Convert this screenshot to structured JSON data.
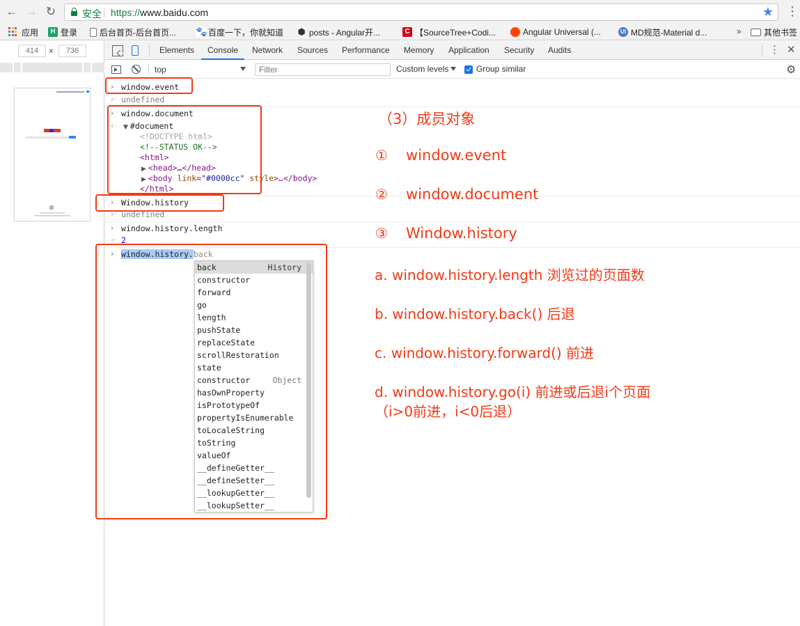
{
  "browser": {
    "secure_label": "安全",
    "url_scheme": "https://",
    "url_host": "www.baidu.com",
    "bookmarks": [
      {
        "label": "应用",
        "icon": "apps-grid-icon"
      },
      {
        "label": "登录",
        "icon": "h-logo-icon"
      },
      {
        "label": "后台首页-后台首页...",
        "icon": "page-icon"
      },
      {
        "label": "百度一下，你就知道",
        "icon": "baidu-paw-icon"
      },
      {
        "label": "posts - Angular开...",
        "icon": "hexagon-icon"
      },
      {
        "label": "【SourceTree+Codi...",
        "icon": "c-logo-icon"
      },
      {
        "label": "Angular Universal (...",
        "icon": "reddit-icon"
      },
      {
        "label": "MD规范-Material d...",
        "icon": "ui-logo-icon"
      }
    ],
    "overflow": "»",
    "other_bookmarks": "其他书签"
  },
  "device": {
    "width": "414",
    "height": "736",
    "x": "×"
  },
  "devtools": {
    "tabs": [
      "Elements",
      "Console",
      "Network",
      "Sources",
      "Performance",
      "Memory",
      "Application",
      "Security",
      "Audits"
    ],
    "active_tab": "Console",
    "context": "top",
    "filter_placeholder": "Filter",
    "levels": "Custom levels",
    "group_similar": "Group similar"
  },
  "console": {
    "l1_cmd": "window.event",
    "l1_res": "undefined",
    "l2_cmd": "window.document",
    "doc_root": "#document",
    "doctype": "<!DOCTYPE html>",
    "status_comment": "<!--STATUS OK-->",
    "html_open": "<html>",
    "head_tag": "<head>",
    "head_ell": "…",
    "head_close": "</head>",
    "body_open": "<body",
    "body_attr": "link",
    "body_eq": "=",
    "body_val": "\"#0000cc\"",
    "body_attr2": "style",
    "body_rest": ">…</body>",
    "html_close": "</html>",
    "l3_cmd": "Window.history",
    "l3_res": "undefined",
    "l4_cmd": "window.history.length",
    "l4_res": "2",
    "l5_typed": "window.history.",
    "l5_hint": "back"
  },
  "autocomplete": {
    "items": [
      {
        "name": "back",
        "type": "History"
      },
      {
        "name": "constructor",
        "type": ""
      },
      {
        "name": "forward",
        "type": ""
      },
      {
        "name": "go",
        "type": ""
      },
      {
        "name": "length",
        "type": ""
      },
      {
        "name": "pushState",
        "type": ""
      },
      {
        "name": "replaceState",
        "type": ""
      },
      {
        "name": "scrollRestoration",
        "type": ""
      },
      {
        "name": "state",
        "type": ""
      },
      {
        "name": "constructor",
        "type": "Object"
      },
      {
        "name": "hasOwnProperty",
        "type": ""
      },
      {
        "name": "isPrototypeOf",
        "type": ""
      },
      {
        "name": "propertyIsEnumerable",
        "type": ""
      },
      {
        "name": "toLocaleString",
        "type": ""
      },
      {
        "name": "toString",
        "type": ""
      },
      {
        "name": "valueOf",
        "type": ""
      },
      {
        "name": "__defineGetter__",
        "type": ""
      },
      {
        "name": "__defineSetter__",
        "type": ""
      },
      {
        "name": "__lookupGetter__",
        "type": ""
      },
      {
        "name": "__lookupSetter__",
        "type": ""
      }
    ]
  },
  "annotations": {
    "heading": "（3）成员对象",
    "items": [
      {
        "marker": "①",
        "text": "window.event"
      },
      {
        "marker": "②",
        "text": "window.document"
      },
      {
        "marker": "③",
        "text": "Window.history"
      }
    ],
    "a": "a. window.history.length 浏览过的页面数",
    "b": "b. window.history.back() 后退",
    "c": "c. window.history.forward() 前进",
    "d": "d. window.history.go(i) 前进或后退i个页面",
    "d2": "（i>0前进，i<0后退）"
  },
  "colors": {
    "annotation": "#f23a16",
    "accent": "#1a73e8",
    "secure": "#0b8043"
  }
}
